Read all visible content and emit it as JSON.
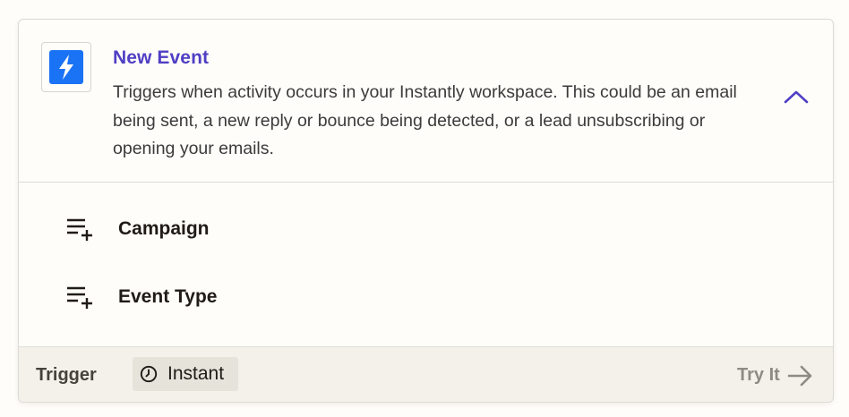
{
  "trigger_card": {
    "app_icon": "lightning-bolt-icon",
    "title": "New Event",
    "description": "Triggers when activity occurs in your Instantly workspace. This could be an email being sent, a new reply or bounce being detected, or a lead unsubscribing or opening your emails.",
    "collapse_icon": "chevron-up-icon",
    "accent_color": "#4f3fc4",
    "logo_color": "#1a73f5"
  },
  "fields": [
    {
      "label": "Campaign",
      "icon": "add-to-list-icon"
    },
    {
      "label": "Event Type",
      "icon": "add-to-list-icon"
    }
  ],
  "footer": {
    "label": "Trigger",
    "badge_icon": "clock-icon",
    "badge_text": "Instant",
    "try_it_label": "Try It",
    "try_it_icon": "arrow-right-icon"
  }
}
